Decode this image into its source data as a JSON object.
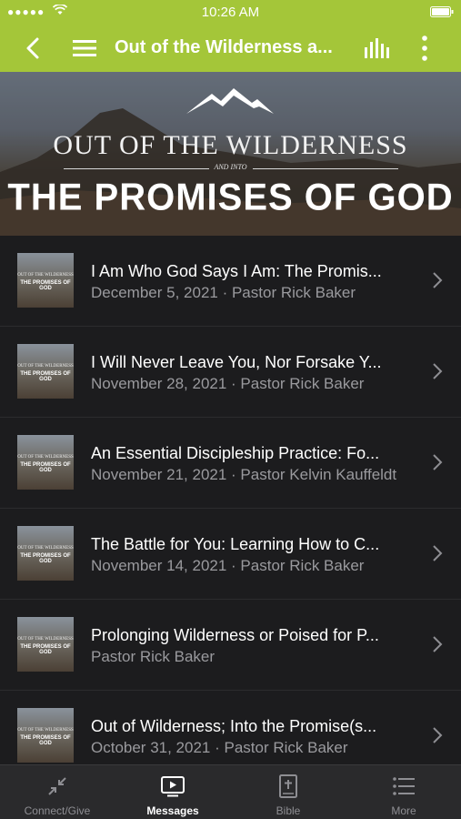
{
  "status_bar": {
    "signal": "●●●●●",
    "time": "10:26 AM"
  },
  "nav": {
    "title": "Out of the Wilderness a..."
  },
  "hero": {
    "line1": "OUT OF THE WILDERNESS",
    "and_into": "AND INTO",
    "line2": "THE PROMISES OF GOD"
  },
  "thumbnail": {
    "line1": "OUT OF THE WILDERNESS",
    "line2": "THE PROMISES OF GOD"
  },
  "messages": [
    {
      "title": "I Am Who God Says I Am: The Promis...",
      "subtitle": "December 5, 2021 · Pastor Rick Baker"
    },
    {
      "title": "I Will Never Leave You, Nor Forsake Y...",
      "subtitle": "November 28, 2021 · Pastor Rick Baker"
    },
    {
      "title": "An Essential Discipleship Practice: Fo...",
      "subtitle": "November 21, 2021 · Pastor Kelvin Kauffeldt"
    },
    {
      "title": "The Battle for You: Learning How to C...",
      "subtitle": "November 14, 2021 · Pastor Rick Baker"
    },
    {
      "title": "Prolonging Wilderness or Poised for P...",
      "subtitle": "Pastor Rick Baker"
    },
    {
      "title": "Out of Wilderness; Into the Promise(s...",
      "subtitle": "October 31, 2021 · Pastor Rick Baker"
    }
  ],
  "tabs": [
    {
      "label": "Connect/Give",
      "icon": "arrows-collapse-icon",
      "active": false
    },
    {
      "label": "Messages",
      "icon": "video-play-icon",
      "active": true
    },
    {
      "label": "Bible",
      "icon": "bible-icon",
      "active": false
    },
    {
      "label": "More",
      "icon": "list-icon",
      "active": false
    }
  ],
  "colors": {
    "accent": "#a4c639",
    "background": "#1c1c1e",
    "tab_bar": "#2a2a2c"
  }
}
